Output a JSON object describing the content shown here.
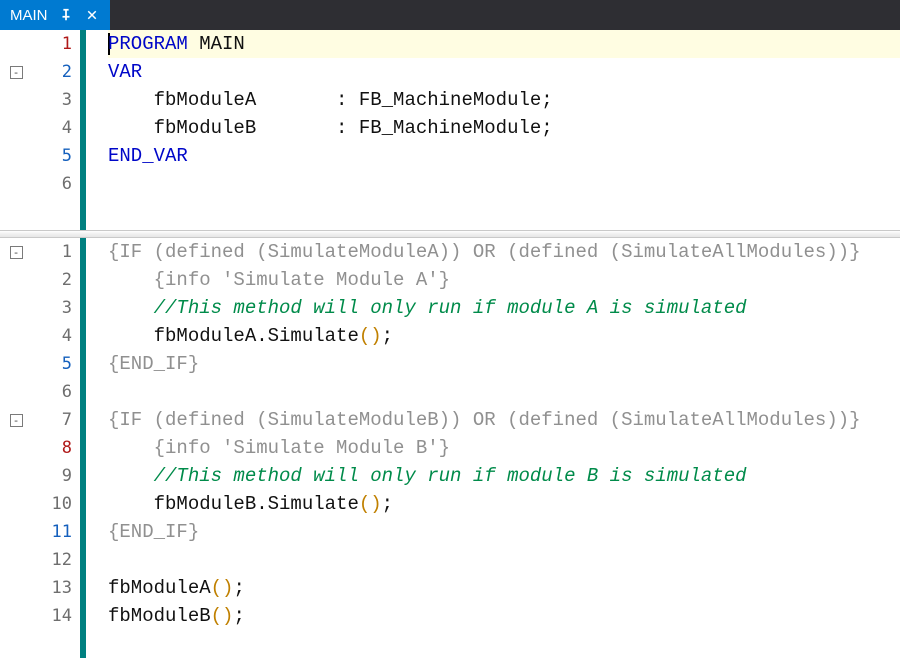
{
  "tab": {
    "title": "MAIN"
  },
  "topPane": {
    "lines": [
      {
        "n": 1,
        "numClass": "breakpointish",
        "fold": "",
        "hl": true,
        "segs": [
          {
            "cursor": true
          },
          {
            "t": "PROGRAM",
            "c": "kw"
          },
          {
            "t": " MAIN",
            "c": "id"
          }
        ]
      },
      {
        "n": 2,
        "numClass": "blueish",
        "fold": "minus",
        "segs": [
          {
            "t": "VAR",
            "c": "kw"
          }
        ]
      },
      {
        "n": 3,
        "numClass": "",
        "segs": [
          {
            "t": "    fbModuleA       : FB_MachineModule;",
            "c": "id"
          }
        ]
      },
      {
        "n": 4,
        "numClass": "",
        "segs": [
          {
            "t": "    fbModuleB       : FB_MachineModule;",
            "c": "id"
          }
        ]
      },
      {
        "n": 5,
        "numClass": "blueish",
        "segs": [
          {
            "t": "END_VAR",
            "c": "kw"
          }
        ]
      },
      {
        "n": 6,
        "numClass": "",
        "segs": [
          {
            "t": "",
            "c": "id"
          }
        ]
      }
    ]
  },
  "bottomPane": {
    "lines": [
      {
        "n": 1,
        "numClass": "",
        "fold": "minus",
        "segs": [
          {
            "t": "{IF (defined (SimulateModuleA)) OR (defined (SimulateAllModules))}",
            "c": "pragma"
          }
        ]
      },
      {
        "n": 2,
        "numClass": "",
        "segs": [
          {
            "t": "    ",
            "c": "id"
          },
          {
            "t": "{info 'Simulate Module A'}",
            "c": "pragma"
          }
        ]
      },
      {
        "n": 3,
        "numClass": "",
        "segs": [
          {
            "t": "    ",
            "c": "id"
          },
          {
            "t": "//This method will only run if module A is simulated",
            "c": "comment"
          }
        ]
      },
      {
        "n": 4,
        "numClass": "",
        "segs": [
          {
            "t": "    fbModuleA.Simulate",
            "c": "id"
          },
          {
            "t": "()",
            "c": "paren"
          },
          {
            "t": ";",
            "c": "id"
          }
        ]
      },
      {
        "n": 5,
        "numClass": "blueish",
        "segs": [
          {
            "t": "{END_IF}",
            "c": "pragma"
          }
        ]
      },
      {
        "n": 6,
        "numClass": "",
        "segs": [
          {
            "t": "",
            "c": "id"
          }
        ]
      },
      {
        "n": 7,
        "numClass": "",
        "fold": "minus",
        "segs": [
          {
            "t": "{IF (defined (SimulateModuleB)) OR (defined (SimulateAllModules))}",
            "c": "pragma"
          }
        ]
      },
      {
        "n": 8,
        "numClass": "breakpointish",
        "segs": [
          {
            "t": "    ",
            "c": "id"
          },
          {
            "t": "{info 'Simulate Module B'}",
            "c": "pragma"
          }
        ]
      },
      {
        "n": 9,
        "numClass": "",
        "segs": [
          {
            "t": "    ",
            "c": "id"
          },
          {
            "t": "//This method will only run if module B is simulated",
            "c": "comment"
          }
        ]
      },
      {
        "n": 10,
        "numClass": "",
        "segs": [
          {
            "t": "    fbModuleB.Simulate",
            "c": "id"
          },
          {
            "t": "()",
            "c": "paren"
          },
          {
            "t": ";",
            "c": "id"
          }
        ]
      },
      {
        "n": 11,
        "numClass": "blueish",
        "segs": [
          {
            "t": "{END_IF}",
            "c": "pragma"
          }
        ]
      },
      {
        "n": 12,
        "numClass": "",
        "segs": [
          {
            "t": "",
            "c": "id"
          }
        ]
      },
      {
        "n": 13,
        "numClass": "",
        "segs": [
          {
            "t": "fbModuleA",
            "c": "id"
          },
          {
            "t": "()",
            "c": "paren"
          },
          {
            "t": ";",
            "c": "id"
          }
        ]
      },
      {
        "n": 14,
        "numClass": "",
        "segs": [
          {
            "t": "fbModuleB",
            "c": "id"
          },
          {
            "t": "()",
            "c": "paren"
          },
          {
            "t": ";",
            "c": "id"
          }
        ]
      }
    ]
  }
}
